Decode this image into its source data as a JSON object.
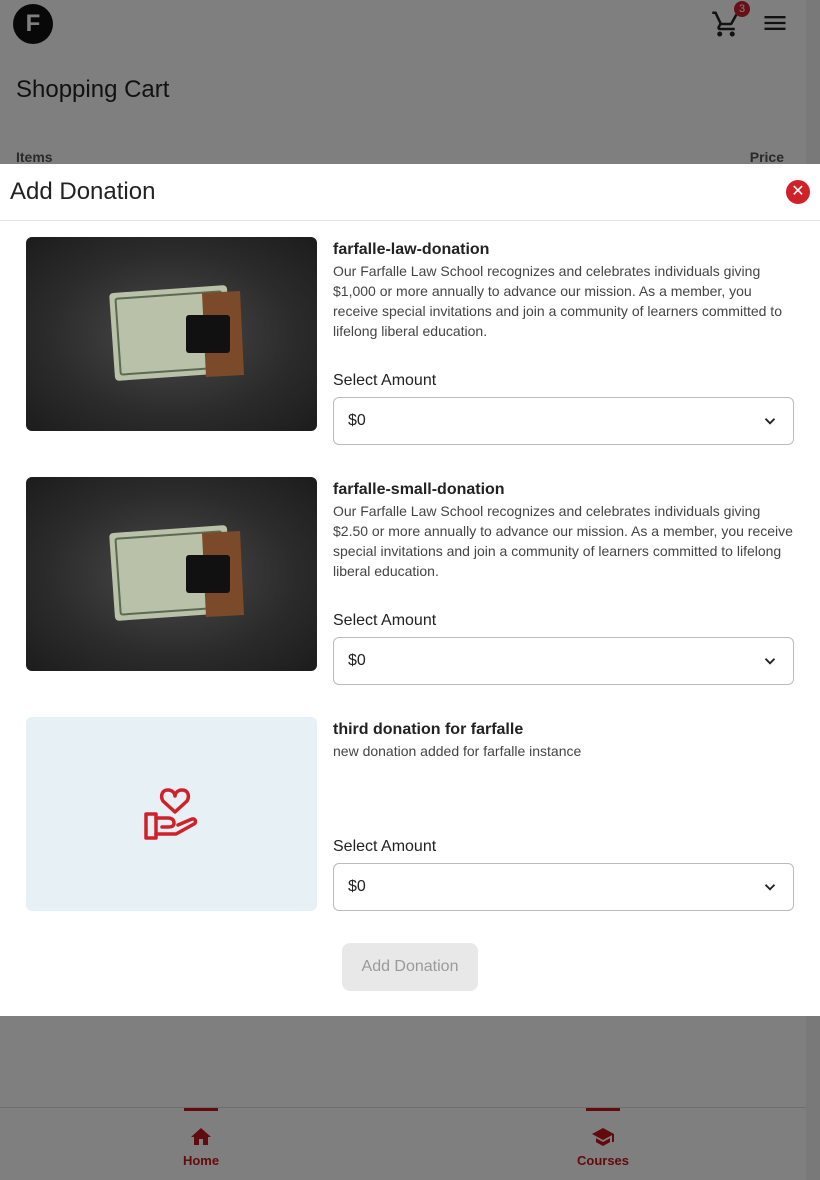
{
  "header": {
    "logo_letter": "F",
    "cart_count": "3"
  },
  "page": {
    "title": "Shopping Cart",
    "columns": {
      "items": "Items",
      "price": "Price"
    }
  },
  "modal": {
    "title": "Add Donation",
    "close_icon": "close-icon",
    "select_label": "Select Amount",
    "donations": [
      {
        "name": "farfalle-law-donation",
        "description": "Our Farfalle Law School recognizes and celebrates individuals giving $1,000 or more annually to advance our mission. As a member, you receive special invitations and join a community of learners committed to lifelong liberal education.",
        "selected_amount": "$0",
        "image": "money-clip-photo"
      },
      {
        "name": "farfalle-small-donation",
        "description": "Our Farfalle Law School recognizes and celebrates individuals giving $2.50 or more annually to advance our mission. As a member, you receive special invitations and join a community of learners committed to lifelong liberal education.",
        "selected_amount": "$0",
        "image": "money-clip-photo"
      },
      {
        "name": "third donation for farfalle",
        "description": "new donation added for farfalle instance",
        "selected_amount": "$0",
        "image": "heart-hand-icon"
      }
    ],
    "submit_label": "Add Donation"
  },
  "bottom_nav": {
    "home": "Home",
    "courses": "Courses"
  },
  "colors": {
    "accent": "#c4161c",
    "close_bg": "#d0212a",
    "image_bg": "#e6f0f5",
    "disabled_btn_bg": "#e8e8e8"
  }
}
